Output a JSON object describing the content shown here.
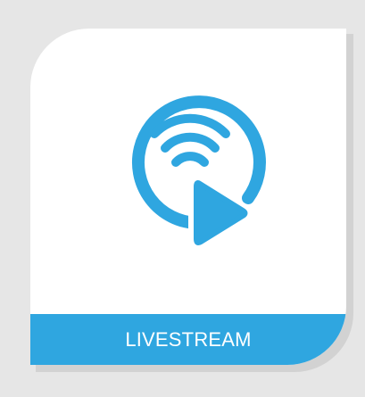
{
  "tile": {
    "label": "LIVESTREAM",
    "icon": "livestream-icon",
    "accent_color": "#2fa6e0"
  }
}
